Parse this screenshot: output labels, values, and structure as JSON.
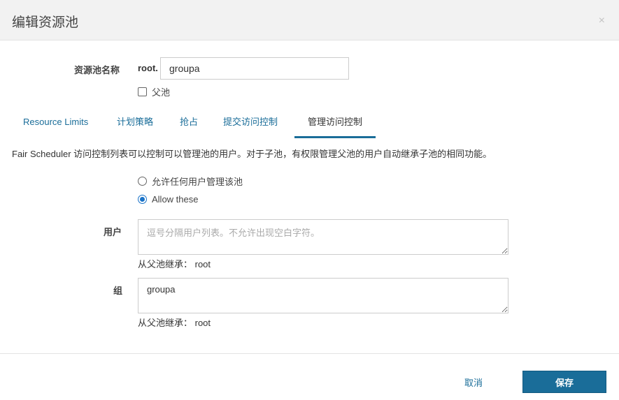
{
  "dialog": {
    "title": "编辑资源池",
    "close_icon": "×"
  },
  "form": {
    "pool_name_label": "资源池名称",
    "pool_prefix": "root.",
    "pool_name_value": "groupa",
    "parent_checkbox_label": "父池",
    "parent_checked": false
  },
  "tabs": [
    {
      "label": "Resource Limits",
      "active": false
    },
    {
      "label": "计划策略",
      "active": false
    },
    {
      "label": "抢占",
      "active": false
    },
    {
      "label": "提交访问控制",
      "active": false
    },
    {
      "label": "管理访问控制",
      "active": true
    }
  ],
  "acl": {
    "description": "Fair Scheduler 访问控制列表可以控制可以管理池的用户。对于子池，有权限管理父池的用户自动继承子池的相同功能。",
    "radio_any_label": "允许任何用户管理该池",
    "radio_these_label": "Allow these",
    "selected": "these",
    "users_label": "用户",
    "users_placeholder": "逗号分隔用户列表。不允许出现空白字符。",
    "users_value": "",
    "users_inherit": "从父池继承： root",
    "groups_label": "组",
    "groups_value": "groupa",
    "groups_inherit": "从父池继承： root"
  },
  "footer": {
    "cancel_label": "取消",
    "save_label": "保存"
  },
  "colors": {
    "accent": "#1a6d99",
    "radio_checked": "#1a73c8"
  }
}
